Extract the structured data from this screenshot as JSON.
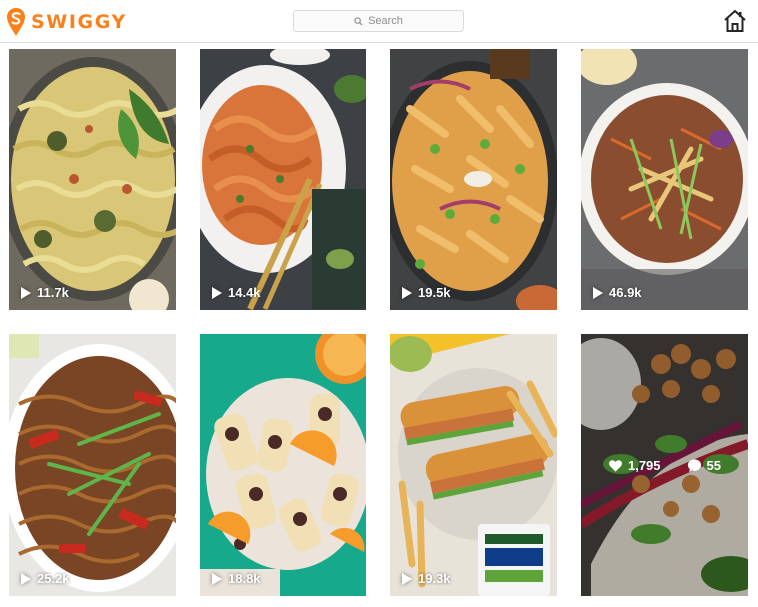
{
  "header": {
    "brand": "SWIGGY",
    "search_placeholder": "Search",
    "brand_color": "#fc8019",
    "icons": {
      "logo": "swiggy-logo-icon",
      "search": "search-icon",
      "home": "home-icon",
      "play": "play-icon",
      "heart": "heart-icon",
      "comment": "comment-icon"
    }
  },
  "posts": [
    {
      "views": "11.7k",
      "dish": "pasta with zucchini and basil"
    },
    {
      "views": "14.4k",
      "dish": "creamy spaghetti with fork"
    },
    {
      "views": "19.5k",
      "dish": "penne with greens"
    },
    {
      "views": "46.9k",
      "dish": "noodle salad bowl"
    },
    {
      "views": "25.2k",
      "dish": "stir fried noodles"
    },
    {
      "views": "18.8k",
      "dish": "ice cream bars with oranges"
    },
    {
      "views": "19.3k",
      "dish": "sub sandwiches with fries"
    },
    {
      "likes": "1,795",
      "comments": "55",
      "dish": "tacos"
    }
  ]
}
